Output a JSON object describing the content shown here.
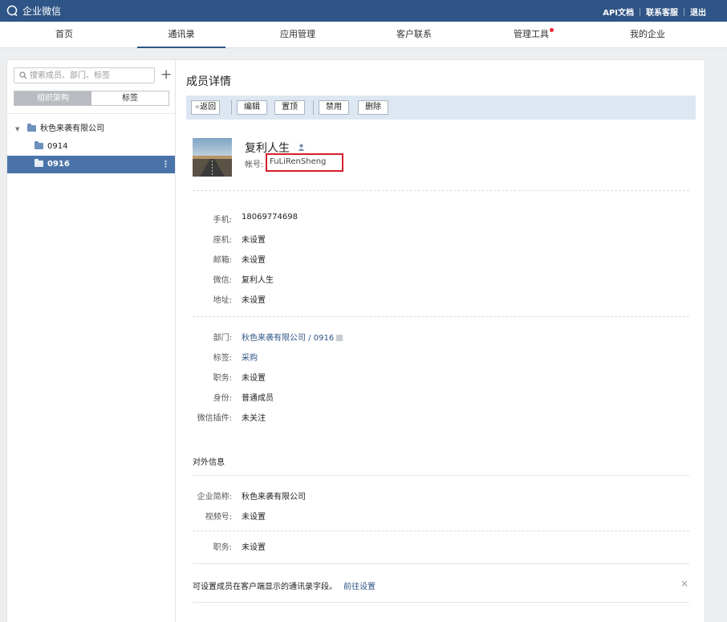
{
  "topbar": {
    "logo_text": "企业微信",
    "links": [
      "API文档",
      "联系客服",
      "退出"
    ]
  },
  "nav": {
    "items": [
      "首页",
      "通讯录",
      "应用管理",
      "客户联系",
      "管理工具",
      "我的企业"
    ],
    "active": "通讯录",
    "badge_on": "管理工具"
  },
  "sidebar": {
    "search_placeholder": "搜索成员、部门、标签",
    "add_symbol": "+",
    "tabs": [
      "组织架构",
      "标签"
    ],
    "tree": {
      "root": "秋色来袭有限公司",
      "children": [
        "0914",
        "0916"
      ],
      "selected": "0916"
    }
  },
  "main": {
    "title": "成员详情",
    "toolbar": {
      "back": "返回",
      "back_glyph": "«",
      "edit": "编辑",
      "pin": "置顶",
      "disable": "禁用",
      "delete": "删除"
    },
    "profile": {
      "name": "复利人生",
      "account_label": "帐号:",
      "account": "FuLiRenSheng"
    },
    "contact": [
      {
        "k": "手机:",
        "v": "18069774698"
      },
      {
        "k": "座机:",
        "v": "未设置"
      },
      {
        "k": "邮箱:",
        "v": "未设置"
      },
      {
        "k": "微信:",
        "v": "复利人生"
      },
      {
        "k": "地址:",
        "v": "未设置"
      }
    ],
    "org": {
      "dept_label": "部门:",
      "dept_value": "秋色来袭有限公司 / 0916",
      "rows": [
        {
          "k": "标签:",
          "v": "采购"
        },
        {
          "k": "职务:",
          "v": "未设置"
        },
        {
          "k": "身份:",
          "v": "普通成员"
        },
        {
          "k": "微信插件:",
          "v": "未关注"
        }
      ]
    },
    "external": {
      "title": "对外信息",
      "rows": [
        {
          "k": "企业简称:",
          "v": "秋色来袭有限公司"
        },
        {
          "k": "视频号:",
          "v": "未设置"
        }
      ],
      "extra": {
        "k": "职务:",
        "v": "未设置"
      }
    },
    "tip": {
      "text": "可设置成员在客户端显示的通讯录字段。",
      "link": "前往设置",
      "close": "×"
    }
  },
  "colors": {
    "topbar": "#2f5586",
    "selected_row": "#4a74a9",
    "toolbar_bg": "#dde7f1",
    "highlight_box": "#d81e2b"
  }
}
